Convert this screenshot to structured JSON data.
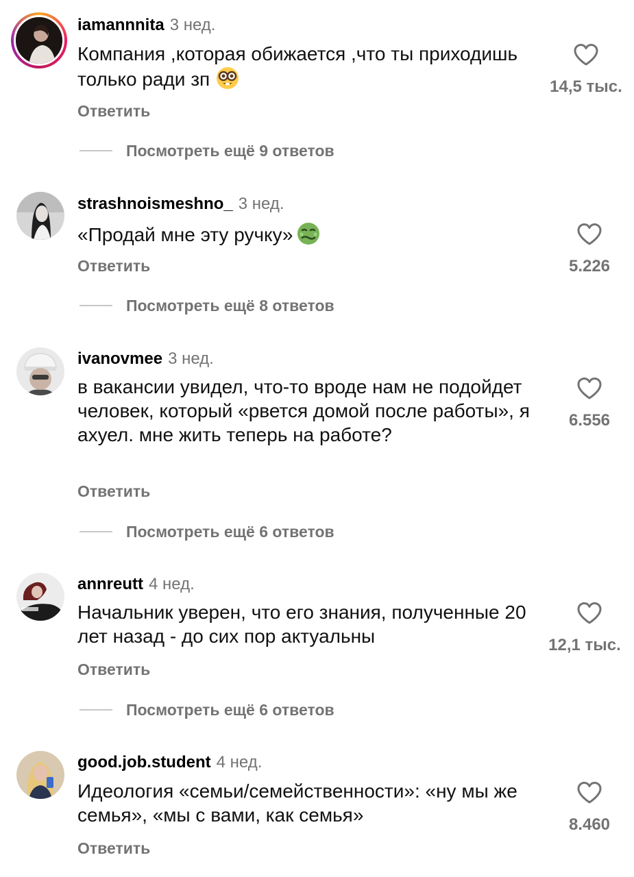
{
  "comments": [
    {
      "username": "iamannnita",
      "time": "3 нед.",
      "text": "Компания ,которая обижается ,что ты приходишь только ради зп",
      "emoji": "nerd-face-emoji",
      "reply_label": "Ответить",
      "view_more": "Посмотреть ещё 9 ответов",
      "likes": "14,5 тыс."
    },
    {
      "username": "strashnoismeshno_",
      "time": "3 нед.",
      "text": "«Продай мне эту ручку»",
      "emoji": "nauseated-face-emoji",
      "reply_label": "Ответить",
      "view_more": "Посмотреть ещё 8 ответов",
      "likes": "5.226"
    },
    {
      "username": "ivanovmee",
      "time": "3 нед.",
      "text": "в вакансии увидел, что-то вроде нам не подойдет человек, который «рвется домой после работы», я ахуел. мне жить теперь на работе?",
      "reply_label": "Ответить",
      "view_more": "Посмотреть ещё 6 ответов",
      "likes": "6.556"
    },
    {
      "username": "annreutt",
      "time": "4 нед.",
      "text": "Начальник уверен, что его знания, полученные 20 лет назад - до сих пор актуальны",
      "reply_label": "Ответить",
      "view_more": "Посмотреть ещё 6 ответов",
      "likes": "12,1 тыс."
    },
    {
      "username": "good.job.student",
      "time": "4 нед.",
      "text": "Идеология «семьи/семейственности»: «ну мы же семья», «мы с вами, как семья»",
      "reply_label": "Ответить",
      "likes": "8.460"
    }
  ],
  "colors": {
    "secondary_text": "#737373",
    "story_ring": [
      "#f9a825",
      "#e91e63",
      "#9c27b0"
    ]
  },
  "icons": {
    "like": "heart-outline-icon"
  }
}
